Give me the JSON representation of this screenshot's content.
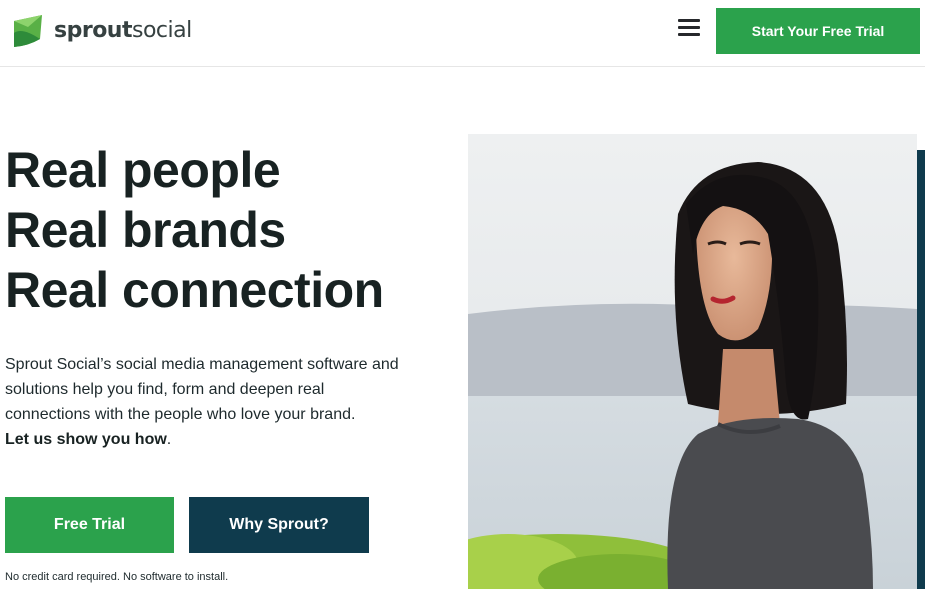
{
  "header": {
    "logo_bold": "sprout",
    "logo_light": "social",
    "menu_icon": "hamburger-menu-icon",
    "cta_label": "Start Your Free Trial"
  },
  "hero": {
    "headline": [
      "Real people",
      "Real brands",
      "Real connection"
    ],
    "lede": "Sprout Social’s social media management software and solutions help you find, form and deepen real connections with the people who love your brand.",
    "lede_cta": "Let us show you how",
    "lede_end": ".",
    "primary_button": "Free Trial",
    "secondary_button": "Why Sprout?",
    "fineprint": "No credit card required. No software to install."
  },
  "colors": {
    "brand_green": "#2ba24c",
    "brand_navy": "#0f3b4d",
    "headline": "#182222"
  }
}
